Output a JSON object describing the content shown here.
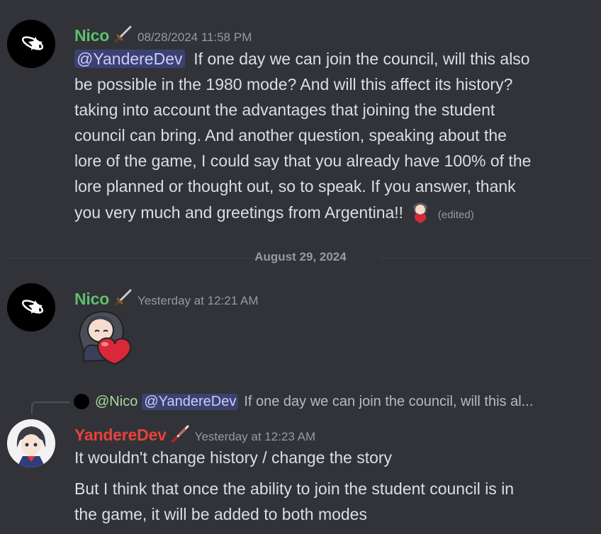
{
  "colors": {
    "background": "#313338",
    "nico_name": "#5fbf6e",
    "yanderedev_name": "#e9413a",
    "mention_bg": "#3c4270",
    "timestamp": "#949ba4"
  },
  "messages": [
    {
      "author": "Nico",
      "badge_icon": "dagger-icon",
      "timestamp": "08/28/2024 11:58 PM",
      "mention": "@YandereDev",
      "lines": [
        "If one day we can join the council, will this also",
        "be possible in the 1980 mode? And will this affect its history?",
        "taking into account the advantages that joining the student",
        "council can bring. And another question, speaking about the",
        "lore of the game, I could say that you already have 100% of the",
        "lore planned or thought out, so to speak. If you answer, thank",
        "you very much and greetings from Argentina!!"
      ],
      "edited": "(edited)"
    },
    {
      "author": "Nico",
      "badge_icon": "dagger-icon",
      "timestamp": "Yesterday at 12:21 AM",
      "sticker_icon": "girl-hugging-heart-sticker"
    },
    {
      "author": "YandereDev",
      "badge_icon": "red-knife-icon",
      "timestamp": "Yesterday at 12:23 AM",
      "lines": [
        "It wouldn't change history / change the story"
      ],
      "lines2": [
        "But I think that once the ability to join the student council is in",
        "the game, it will be added to both modes"
      ]
    }
  ],
  "date_divider": "August 29, 2024",
  "reply_preview": {
    "author": "@Nico",
    "mention": "@YandereDev",
    "text": "If one day we can join the council, will this al..."
  }
}
